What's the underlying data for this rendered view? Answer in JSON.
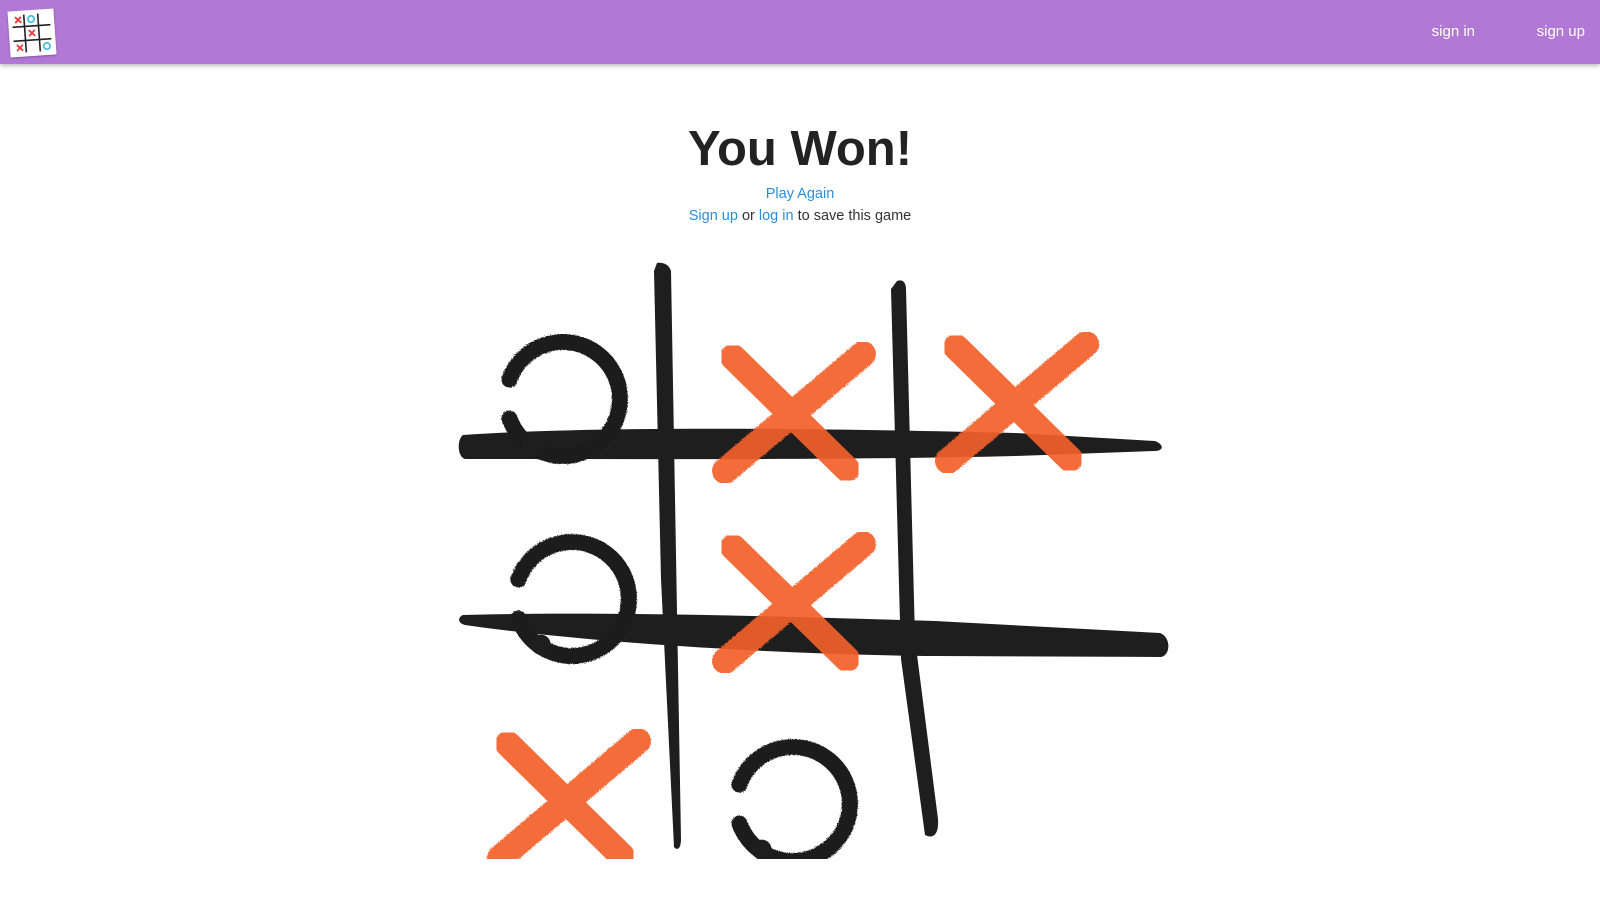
{
  "colors": {
    "navbar": "#b278d6",
    "link": "#2a8fd6",
    "ink": "#1e1e1e",
    "x_mark": "#f2602a"
  },
  "nav": {
    "logo_icon": "tic-tac-toe-logo-icon",
    "sign_in": "sign in",
    "sign_up": "sign up"
  },
  "result": {
    "title": "You Won!",
    "play_again": "Play Again",
    "save_signup": "Sign up",
    "save_or": "or",
    "save_login": "log in",
    "save_suffix": "to save this game"
  },
  "board": {
    "cells": [
      "O",
      "X",
      "X",
      "O",
      "X",
      "",
      "X",
      "O",
      ""
    ]
  }
}
